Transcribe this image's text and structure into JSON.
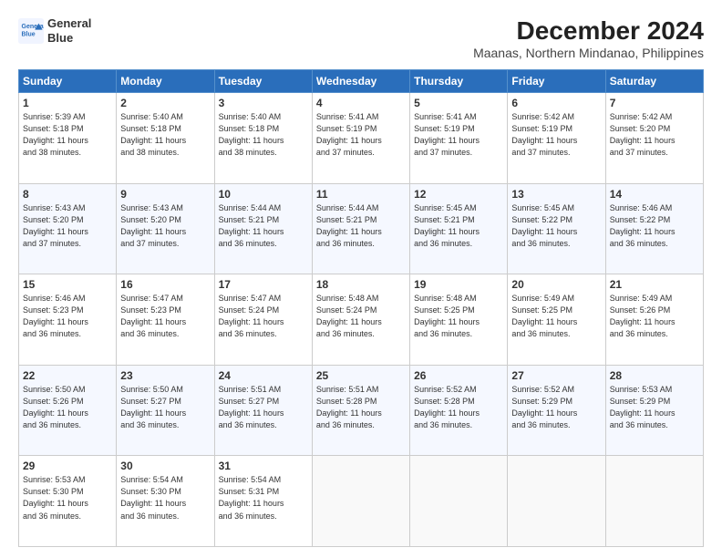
{
  "header": {
    "logo_line1": "General",
    "logo_line2": "Blue",
    "month_title": "December 2024",
    "location": "Maanas, Northern Mindanao, Philippines"
  },
  "days_of_week": [
    "Sunday",
    "Monday",
    "Tuesday",
    "Wednesday",
    "Thursday",
    "Friday",
    "Saturday"
  ],
  "weeks": [
    [
      {
        "day": "1",
        "info": "Sunrise: 5:39 AM\nSunset: 5:18 PM\nDaylight: 11 hours\nand 38 minutes."
      },
      {
        "day": "2",
        "info": "Sunrise: 5:40 AM\nSunset: 5:18 PM\nDaylight: 11 hours\nand 38 minutes."
      },
      {
        "day": "3",
        "info": "Sunrise: 5:40 AM\nSunset: 5:18 PM\nDaylight: 11 hours\nand 38 minutes."
      },
      {
        "day": "4",
        "info": "Sunrise: 5:41 AM\nSunset: 5:19 PM\nDaylight: 11 hours\nand 37 minutes."
      },
      {
        "day": "5",
        "info": "Sunrise: 5:41 AM\nSunset: 5:19 PM\nDaylight: 11 hours\nand 37 minutes."
      },
      {
        "day": "6",
        "info": "Sunrise: 5:42 AM\nSunset: 5:19 PM\nDaylight: 11 hours\nand 37 minutes."
      },
      {
        "day": "7",
        "info": "Sunrise: 5:42 AM\nSunset: 5:20 PM\nDaylight: 11 hours\nand 37 minutes."
      }
    ],
    [
      {
        "day": "8",
        "info": "Sunrise: 5:43 AM\nSunset: 5:20 PM\nDaylight: 11 hours\nand 37 minutes."
      },
      {
        "day": "9",
        "info": "Sunrise: 5:43 AM\nSunset: 5:20 PM\nDaylight: 11 hours\nand 37 minutes."
      },
      {
        "day": "10",
        "info": "Sunrise: 5:44 AM\nSunset: 5:21 PM\nDaylight: 11 hours\nand 36 minutes."
      },
      {
        "day": "11",
        "info": "Sunrise: 5:44 AM\nSunset: 5:21 PM\nDaylight: 11 hours\nand 36 minutes."
      },
      {
        "day": "12",
        "info": "Sunrise: 5:45 AM\nSunset: 5:21 PM\nDaylight: 11 hours\nand 36 minutes."
      },
      {
        "day": "13",
        "info": "Sunrise: 5:45 AM\nSunset: 5:22 PM\nDaylight: 11 hours\nand 36 minutes."
      },
      {
        "day": "14",
        "info": "Sunrise: 5:46 AM\nSunset: 5:22 PM\nDaylight: 11 hours\nand 36 minutes."
      }
    ],
    [
      {
        "day": "15",
        "info": "Sunrise: 5:46 AM\nSunset: 5:23 PM\nDaylight: 11 hours\nand 36 minutes."
      },
      {
        "day": "16",
        "info": "Sunrise: 5:47 AM\nSunset: 5:23 PM\nDaylight: 11 hours\nand 36 minutes."
      },
      {
        "day": "17",
        "info": "Sunrise: 5:47 AM\nSunset: 5:24 PM\nDaylight: 11 hours\nand 36 minutes."
      },
      {
        "day": "18",
        "info": "Sunrise: 5:48 AM\nSunset: 5:24 PM\nDaylight: 11 hours\nand 36 minutes."
      },
      {
        "day": "19",
        "info": "Sunrise: 5:48 AM\nSunset: 5:25 PM\nDaylight: 11 hours\nand 36 minutes."
      },
      {
        "day": "20",
        "info": "Sunrise: 5:49 AM\nSunset: 5:25 PM\nDaylight: 11 hours\nand 36 minutes."
      },
      {
        "day": "21",
        "info": "Sunrise: 5:49 AM\nSunset: 5:26 PM\nDaylight: 11 hours\nand 36 minutes."
      }
    ],
    [
      {
        "day": "22",
        "info": "Sunrise: 5:50 AM\nSunset: 5:26 PM\nDaylight: 11 hours\nand 36 minutes."
      },
      {
        "day": "23",
        "info": "Sunrise: 5:50 AM\nSunset: 5:27 PM\nDaylight: 11 hours\nand 36 minutes."
      },
      {
        "day": "24",
        "info": "Sunrise: 5:51 AM\nSunset: 5:27 PM\nDaylight: 11 hours\nand 36 minutes."
      },
      {
        "day": "25",
        "info": "Sunrise: 5:51 AM\nSunset: 5:28 PM\nDaylight: 11 hours\nand 36 minutes."
      },
      {
        "day": "26",
        "info": "Sunrise: 5:52 AM\nSunset: 5:28 PM\nDaylight: 11 hours\nand 36 minutes."
      },
      {
        "day": "27",
        "info": "Sunrise: 5:52 AM\nSunset: 5:29 PM\nDaylight: 11 hours\nand 36 minutes."
      },
      {
        "day": "28",
        "info": "Sunrise: 5:53 AM\nSunset: 5:29 PM\nDaylight: 11 hours\nand 36 minutes."
      }
    ],
    [
      {
        "day": "29",
        "info": "Sunrise: 5:53 AM\nSunset: 5:30 PM\nDaylight: 11 hours\nand 36 minutes."
      },
      {
        "day": "30",
        "info": "Sunrise: 5:54 AM\nSunset: 5:30 PM\nDaylight: 11 hours\nand 36 minutes."
      },
      {
        "day": "31",
        "info": "Sunrise: 5:54 AM\nSunset: 5:31 PM\nDaylight: 11 hours\nand 36 minutes."
      },
      null,
      null,
      null,
      null
    ]
  ]
}
